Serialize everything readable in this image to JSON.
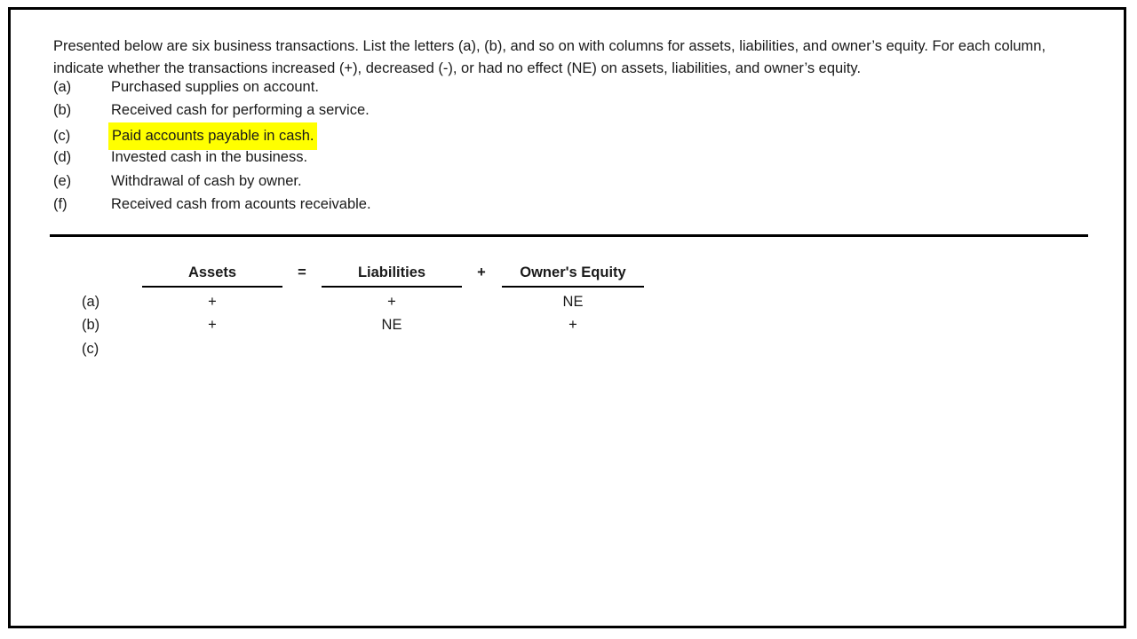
{
  "slide": {
    "intro": "Presented below are six business transactions. List the letters (a), (b), and so on with columns for assets, liabilities, and owner’s equity. For each column, indicate whether the transactions increased (+), decreased (-), or had no effect (NE) on assets, liabilities, and owner’s equity.",
    "highlight_color": "#ffff00",
    "border_color": "#000000"
  },
  "transactions": [
    {
      "letter": "(a)",
      "text": "Purchased supplies on account.",
      "highlighted": false
    },
    {
      "letter": "(b)",
      "text": "Received cash for performing a service.",
      "highlighted": false
    },
    {
      "letter": "(c)",
      "text": "Paid accounts payable  in cash.",
      "highlighted": true
    },
    {
      "letter": "(d)",
      "text": "Invested cash in the business.",
      "highlighted": false
    },
    {
      "letter": "(e)",
      "text": "Withdrawal of cash by owner.",
      "highlighted": false
    },
    {
      "letter": "(f)",
      "text": "Received cash from acounts receivable.",
      "highlighted": false
    }
  ],
  "table": {
    "headers": {
      "row_label": "",
      "assets": "Assets",
      "equals": "=",
      "liabilities": "Liabilities",
      "plus": "+",
      "owners_equity": "Owner's Equity"
    },
    "rows": [
      {
        "letter": "(a)",
        "assets": "+",
        "liabilities": "+",
        "owners_equity": "NE"
      },
      {
        "letter": "(b)",
        "assets": "+",
        "liabilities": "NE",
        "owners_equity": "+"
      },
      {
        "letter": "(c)",
        "assets": "",
        "liabilities": "",
        "owners_equity": ""
      }
    ]
  }
}
